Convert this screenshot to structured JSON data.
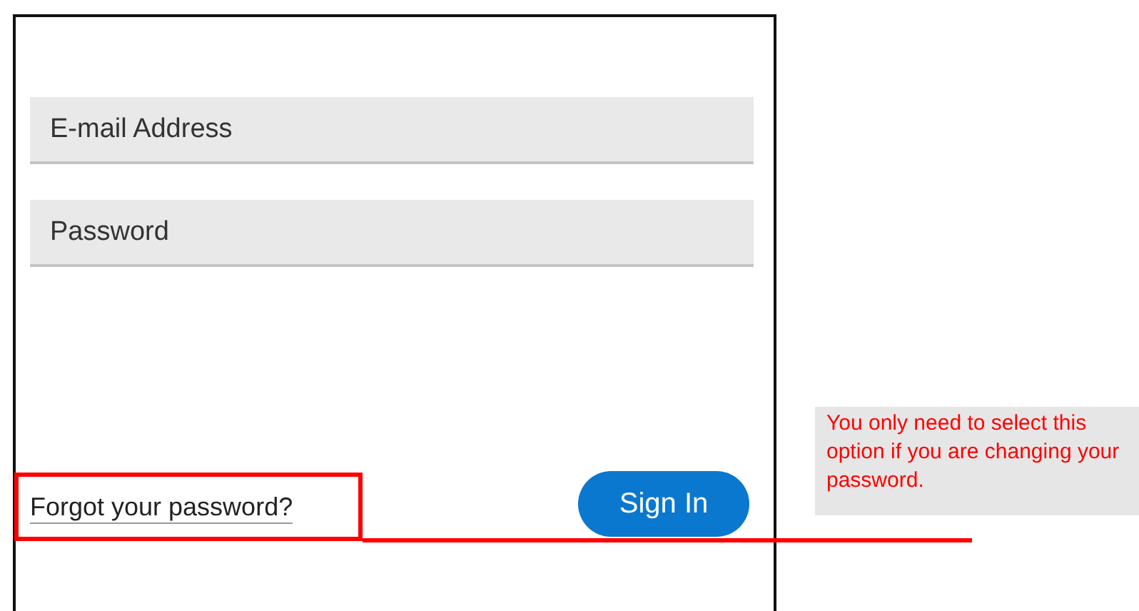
{
  "form": {
    "fields": [
      {
        "placeholder": "E-mail Address"
      },
      {
        "placeholder": "Password"
      }
    ],
    "forgot_link": "Forgot your password?",
    "sign_in_button": "Sign In"
  },
  "annotation": {
    "text": "You only need to select this option if you are changing your password."
  }
}
